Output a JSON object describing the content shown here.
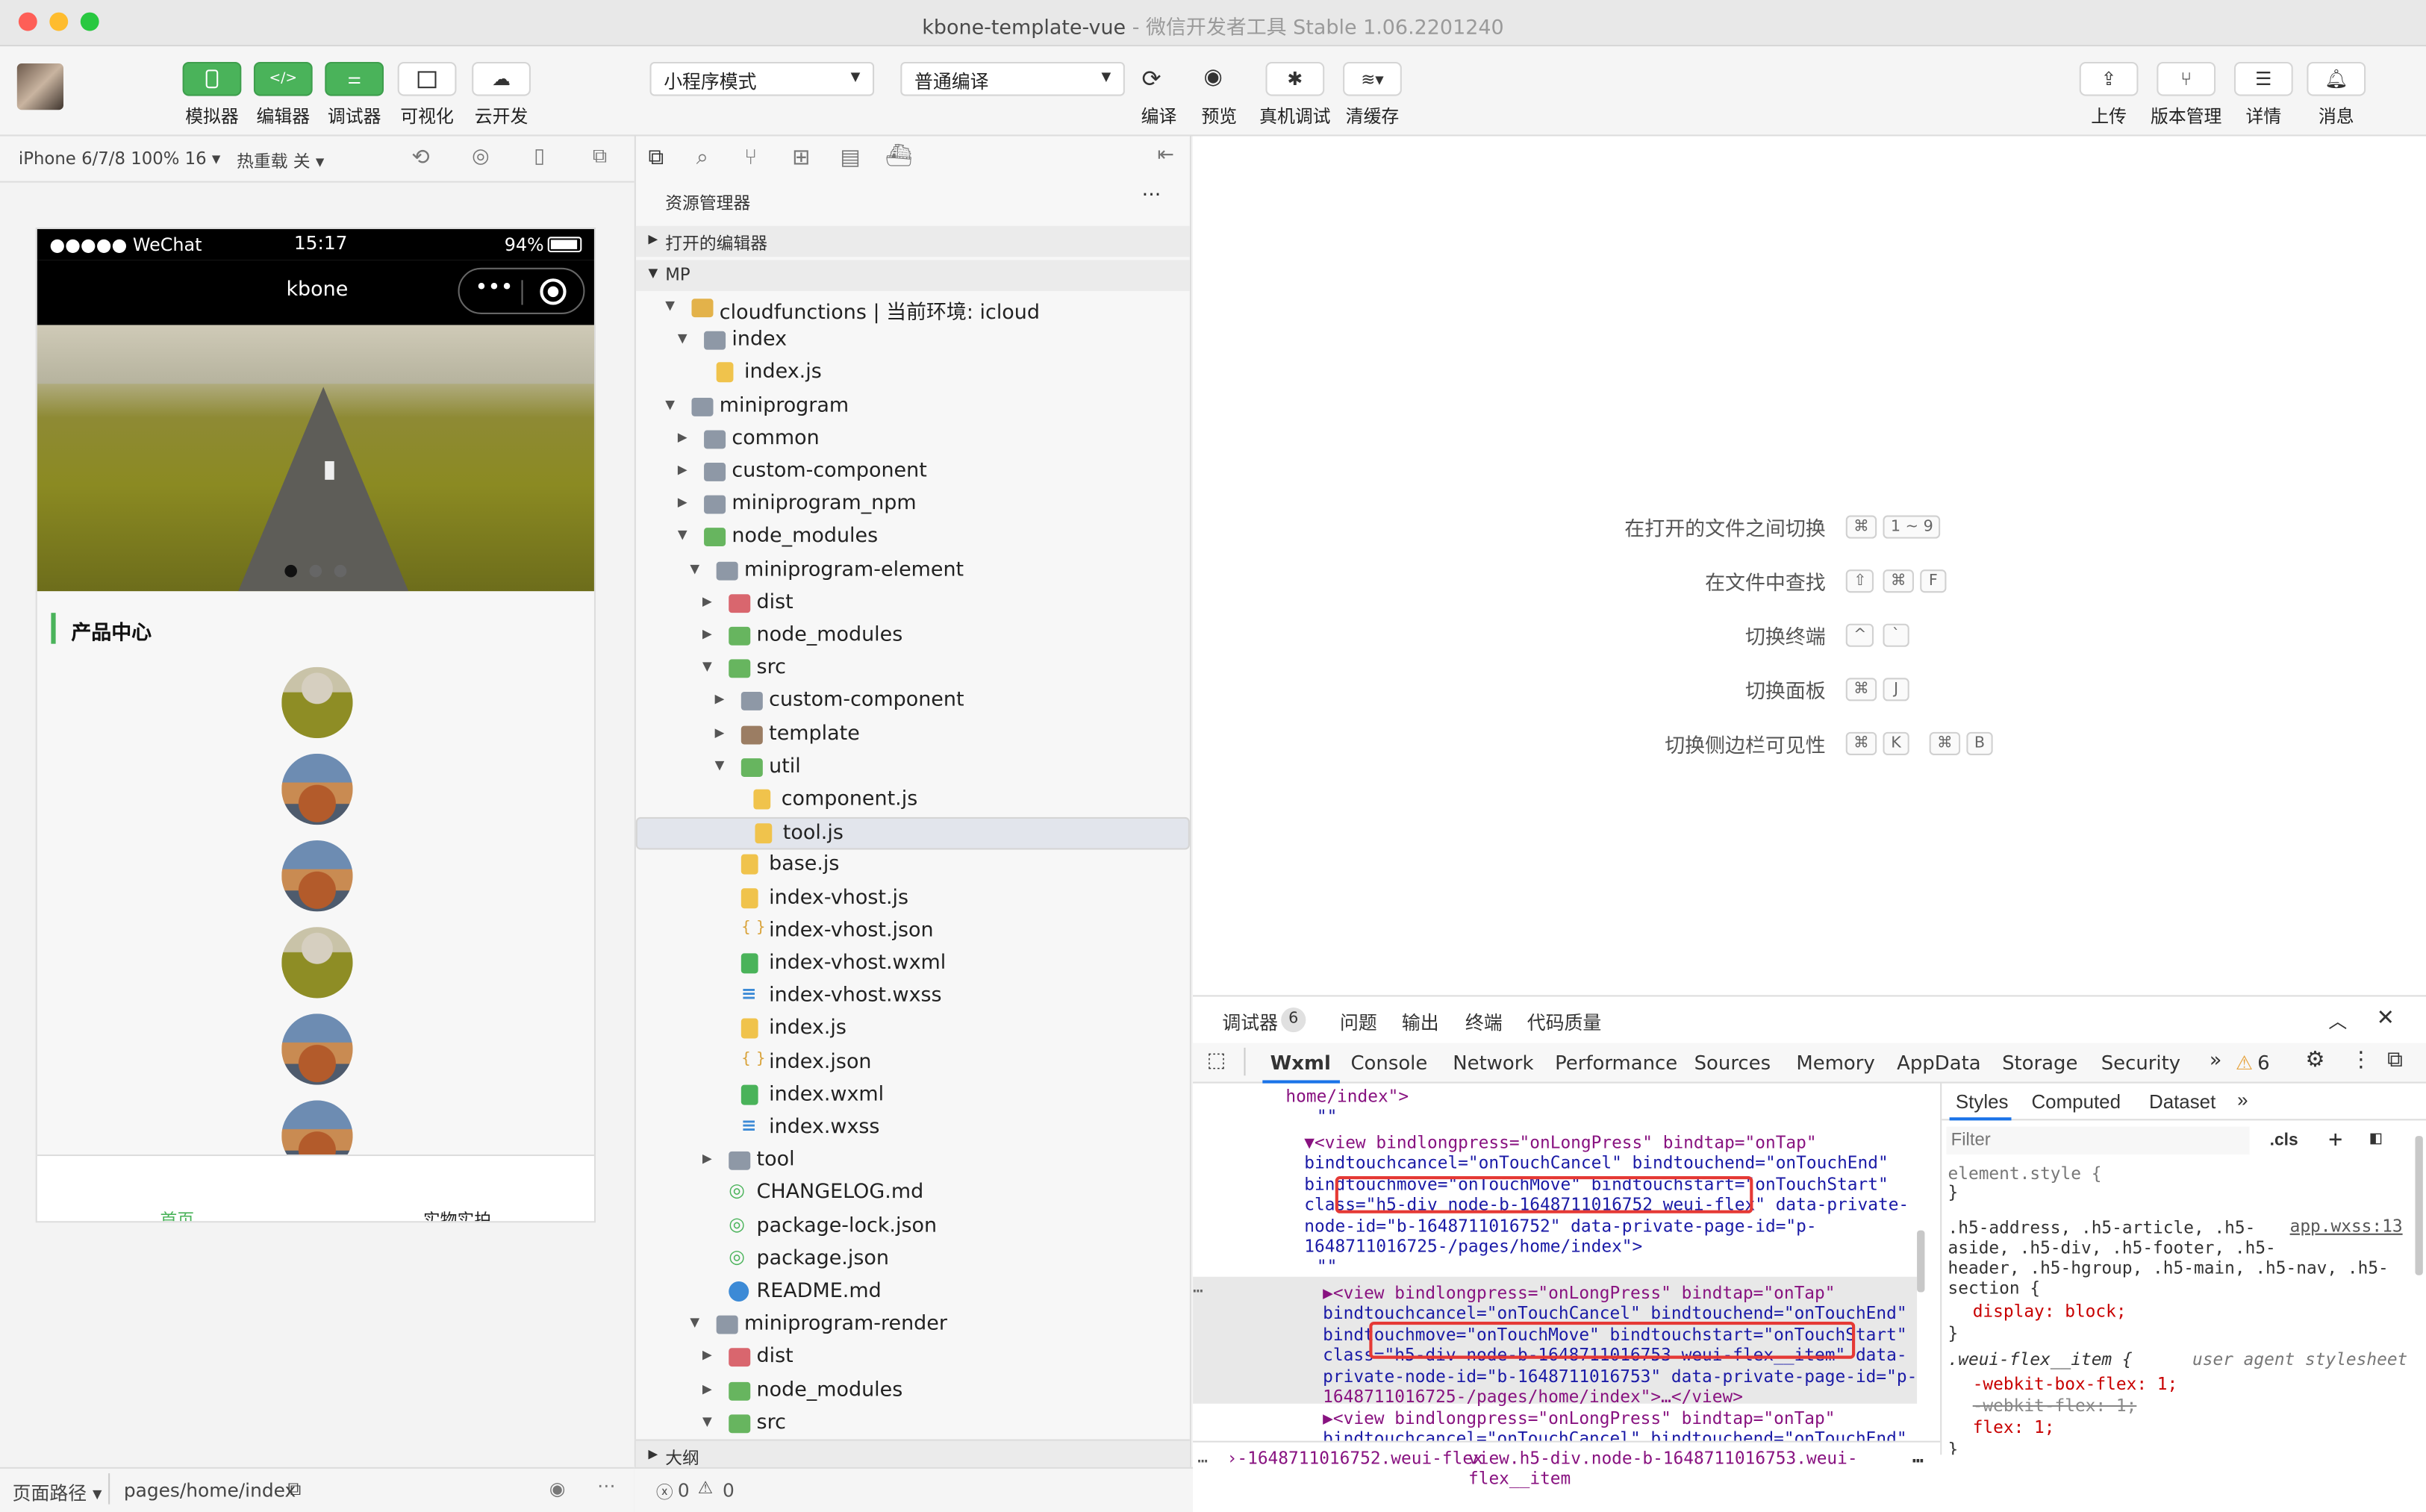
{
  "window": {
    "title": "kbone-template-vue",
    "subtitle": "- 微信开发者工具 Stable 1.06.2201240"
  },
  "toolbar": {
    "left_buttons": [
      "模拟器",
      "编辑器",
      "调试器",
      "可视化",
      "云开发"
    ],
    "mode_select": "小程序模式",
    "compile_select": "普通编译",
    "mid_buttons": [
      "编译",
      "预览",
      "真机调试",
      "清缓存"
    ],
    "right_buttons": [
      "上传",
      "版本管理",
      "详情",
      "消息"
    ]
  },
  "simulator": {
    "device": "iPhone 6/7/8 100% 16",
    "hot_reload": "热重载 关",
    "status_carrier": "●●●●● WeChat",
    "status_time": "15:17",
    "status_battery": "94%",
    "nav_title": "kbone",
    "section_title": "产品中心",
    "tabs": [
      "首页",
      "实物实拍"
    ],
    "path_label": "页面路径",
    "path_value": "pages/home/index"
  },
  "explorer": {
    "title": "资源管理器",
    "open_editors": "打开的编辑器",
    "root": "MP",
    "outline": "大纲",
    "tree": [
      {
        "label": "cloudfunctions | 当前环境: icloud",
        "level": 1,
        "arrow": "down",
        "icon": "fold y"
      },
      {
        "label": "index",
        "level": 2,
        "arrow": "down",
        "icon": "fold"
      },
      {
        "label": "index.js",
        "level": 3,
        "arrow": "",
        "icon": "fjs"
      },
      {
        "label": "miniprogram",
        "level": 1,
        "arrow": "down",
        "icon": "fold"
      },
      {
        "label": "common",
        "level": 2,
        "arrow": "right",
        "icon": "fold"
      },
      {
        "label": "custom-component",
        "level": 2,
        "arrow": "right",
        "icon": "fold"
      },
      {
        "label": "miniprogram_npm",
        "level": 2,
        "arrow": "right",
        "icon": "fold"
      },
      {
        "label": "node_modules",
        "level": 2,
        "arrow": "down",
        "icon": "fold g"
      },
      {
        "label": "miniprogram-element",
        "level": 3,
        "arrow": "down",
        "icon": "fold"
      },
      {
        "label": "dist",
        "level": 4,
        "arrow": "right",
        "icon": "fold r"
      },
      {
        "label": "node_modules",
        "level": 4,
        "arrow": "right",
        "icon": "fold g"
      },
      {
        "label": "src",
        "level": 4,
        "arrow": "down",
        "icon": "fold g"
      },
      {
        "label": "custom-component",
        "level": 5,
        "arrow": "right",
        "icon": "fold"
      },
      {
        "label": "template",
        "level": 5,
        "arrow": "right",
        "icon": "fold br"
      },
      {
        "label": "util",
        "level": 5,
        "arrow": "down",
        "icon": "fold g"
      },
      {
        "label": "component.js",
        "level": 6,
        "arrow": "",
        "icon": "fjs"
      },
      {
        "label": "tool.js",
        "level": 6,
        "arrow": "",
        "icon": "fjs",
        "selected": true
      },
      {
        "label": "base.js",
        "level": 5,
        "arrow": "",
        "icon": "fjs"
      },
      {
        "label": "index-vhost.js",
        "level": 5,
        "arrow": "",
        "icon": "fjs"
      },
      {
        "label": "index-vhost.json",
        "level": 5,
        "arrow": "",
        "icon": "fjson"
      },
      {
        "label": "index-vhost.wxml",
        "level": 5,
        "arrow": "",
        "icon": "fwx"
      },
      {
        "label": "index-vhost.wxss",
        "level": 5,
        "arrow": "",
        "icon": "fwxss"
      },
      {
        "label": "index.js",
        "level": 5,
        "arrow": "",
        "icon": "fjs"
      },
      {
        "label": "index.json",
        "level": 5,
        "arrow": "",
        "icon": "fjson"
      },
      {
        "label": "index.wxml",
        "level": 5,
        "arrow": "",
        "icon": "fwx"
      },
      {
        "label": "index.wxss",
        "level": 5,
        "arrow": "",
        "icon": "fwxss"
      },
      {
        "label": "tool",
        "level": 4,
        "arrow": "right",
        "icon": "fold"
      },
      {
        "label": "CHANGELOG.md",
        "level": 4,
        "arrow": "",
        "icon": "fmd"
      },
      {
        "label": "package-lock.json",
        "level": 4,
        "arrow": "",
        "icon": "fmd"
      },
      {
        "label": "package.json",
        "level": 4,
        "arrow": "",
        "icon": "fmd"
      },
      {
        "label": "README.md",
        "level": 4,
        "arrow": "",
        "icon": "finfo"
      },
      {
        "label": "miniprogram-render",
        "level": 3,
        "arrow": "down",
        "icon": "fold"
      },
      {
        "label": "dist",
        "level": 4,
        "arrow": "right",
        "icon": "fold r"
      },
      {
        "label": "node_modules",
        "level": 4,
        "arrow": "right",
        "icon": "fold g"
      },
      {
        "label": "src",
        "level": 4,
        "arrow": "down",
        "icon": "fold g"
      }
    ]
  },
  "editor": {
    "hints": [
      {
        "label": "在打开的文件之间切换",
        "keys": [
          "⌘",
          "1 ~ 9"
        ]
      },
      {
        "label": "在文件中查找",
        "keys": [
          "⇧",
          "⌘",
          "F"
        ]
      },
      {
        "label": "切换终端",
        "keys": [
          "^",
          "`"
        ]
      },
      {
        "label": "切换面板",
        "keys": [
          "⌘",
          "J"
        ]
      },
      {
        "label": "切换侧边栏可见性",
        "keys": [
          "⌘",
          "K",
          "⌘",
          "B"
        ]
      }
    ]
  },
  "devtools": {
    "top_tabs": [
      "调试器",
      "问题",
      "输出",
      "终端",
      "代码质量"
    ],
    "debugger_badge": "6",
    "panel_tabs": [
      "Wxml",
      "Console",
      "Network",
      "Performance",
      "Sources",
      "Memory",
      "AppData",
      "Storage",
      "Security"
    ],
    "more": "»",
    "warn_count": "6",
    "style_tabs": [
      "Styles",
      "Computed",
      "Dataset"
    ],
    "filter_placeholder": "Filter",
    "cls": ".cls",
    "code_lines": [
      "home/index\">",
      "\"\"",
      "▼<view bindlongpress=\"onLongPress\" bindtap=\"onTap\"",
      "bindtouchcancel=\"onTouchCancel\" bindtouchend=\"onTouchEnd\"",
      "bindtouchmove=\"onTouchMove\" bindtouchstart=\"onTouchStart\"",
      "class=\"h5-div node-b-1648711016752 weui-flex\" data-private-",
      "node-id=\"b-1648711016752\" data-private-page-id=\"p-",
      "1648711016725-/pages/home/index\">",
      "\"\"",
      "▶<view bindlongpress=\"onLongPress\" bindtap=\"onTap\"",
      "bindtouchcancel=\"onTouchCancel\" bindtouchend=\"onTouchEnd\"",
      "bindtouchmove=\"onTouchMove\" bindtouchstart=\"onTouchStart\"",
      "class=\"h5-div node-b-1648711016753 weui-flex__item\" data-",
      "private-node-id=\"b-1648711016753\" data-private-page-id=\"p-",
      "1648711016725-/pages/home/index\">…</view>",
      "▶<view bindlongpress=\"onLongPress\" bindtap=\"onTap\"",
      "bindtouchcancel=\"onTouchCancel\" bindtouchend=\"onTouchEnd\""
    ],
    "styles_lines": [
      "element.style {",
      "}",
      ".h5-address, .h5-article, .h5-",
      "aside, .h5-div, .h5-footer, .h5-",
      "header, .h5-hgroup, .h5-main, .h5-nav, .h5-",
      "section {",
      "display: block;",
      "}",
      ".weui-flex__item {",
      "-webkit-box-flex: 1;",
      "-webkit-flex: 1;",
      "flex: 1;",
      "}"
    ],
    "styles_source": "app.wxss:13",
    "ua_label": "user agent stylesheet",
    "crumb1": "›-1648711016752.weui-flex",
    "crumb2": "view.h5-div.node-b-1648711016753.weui-flex__item",
    "errors": "0",
    "warnings": "0"
  }
}
